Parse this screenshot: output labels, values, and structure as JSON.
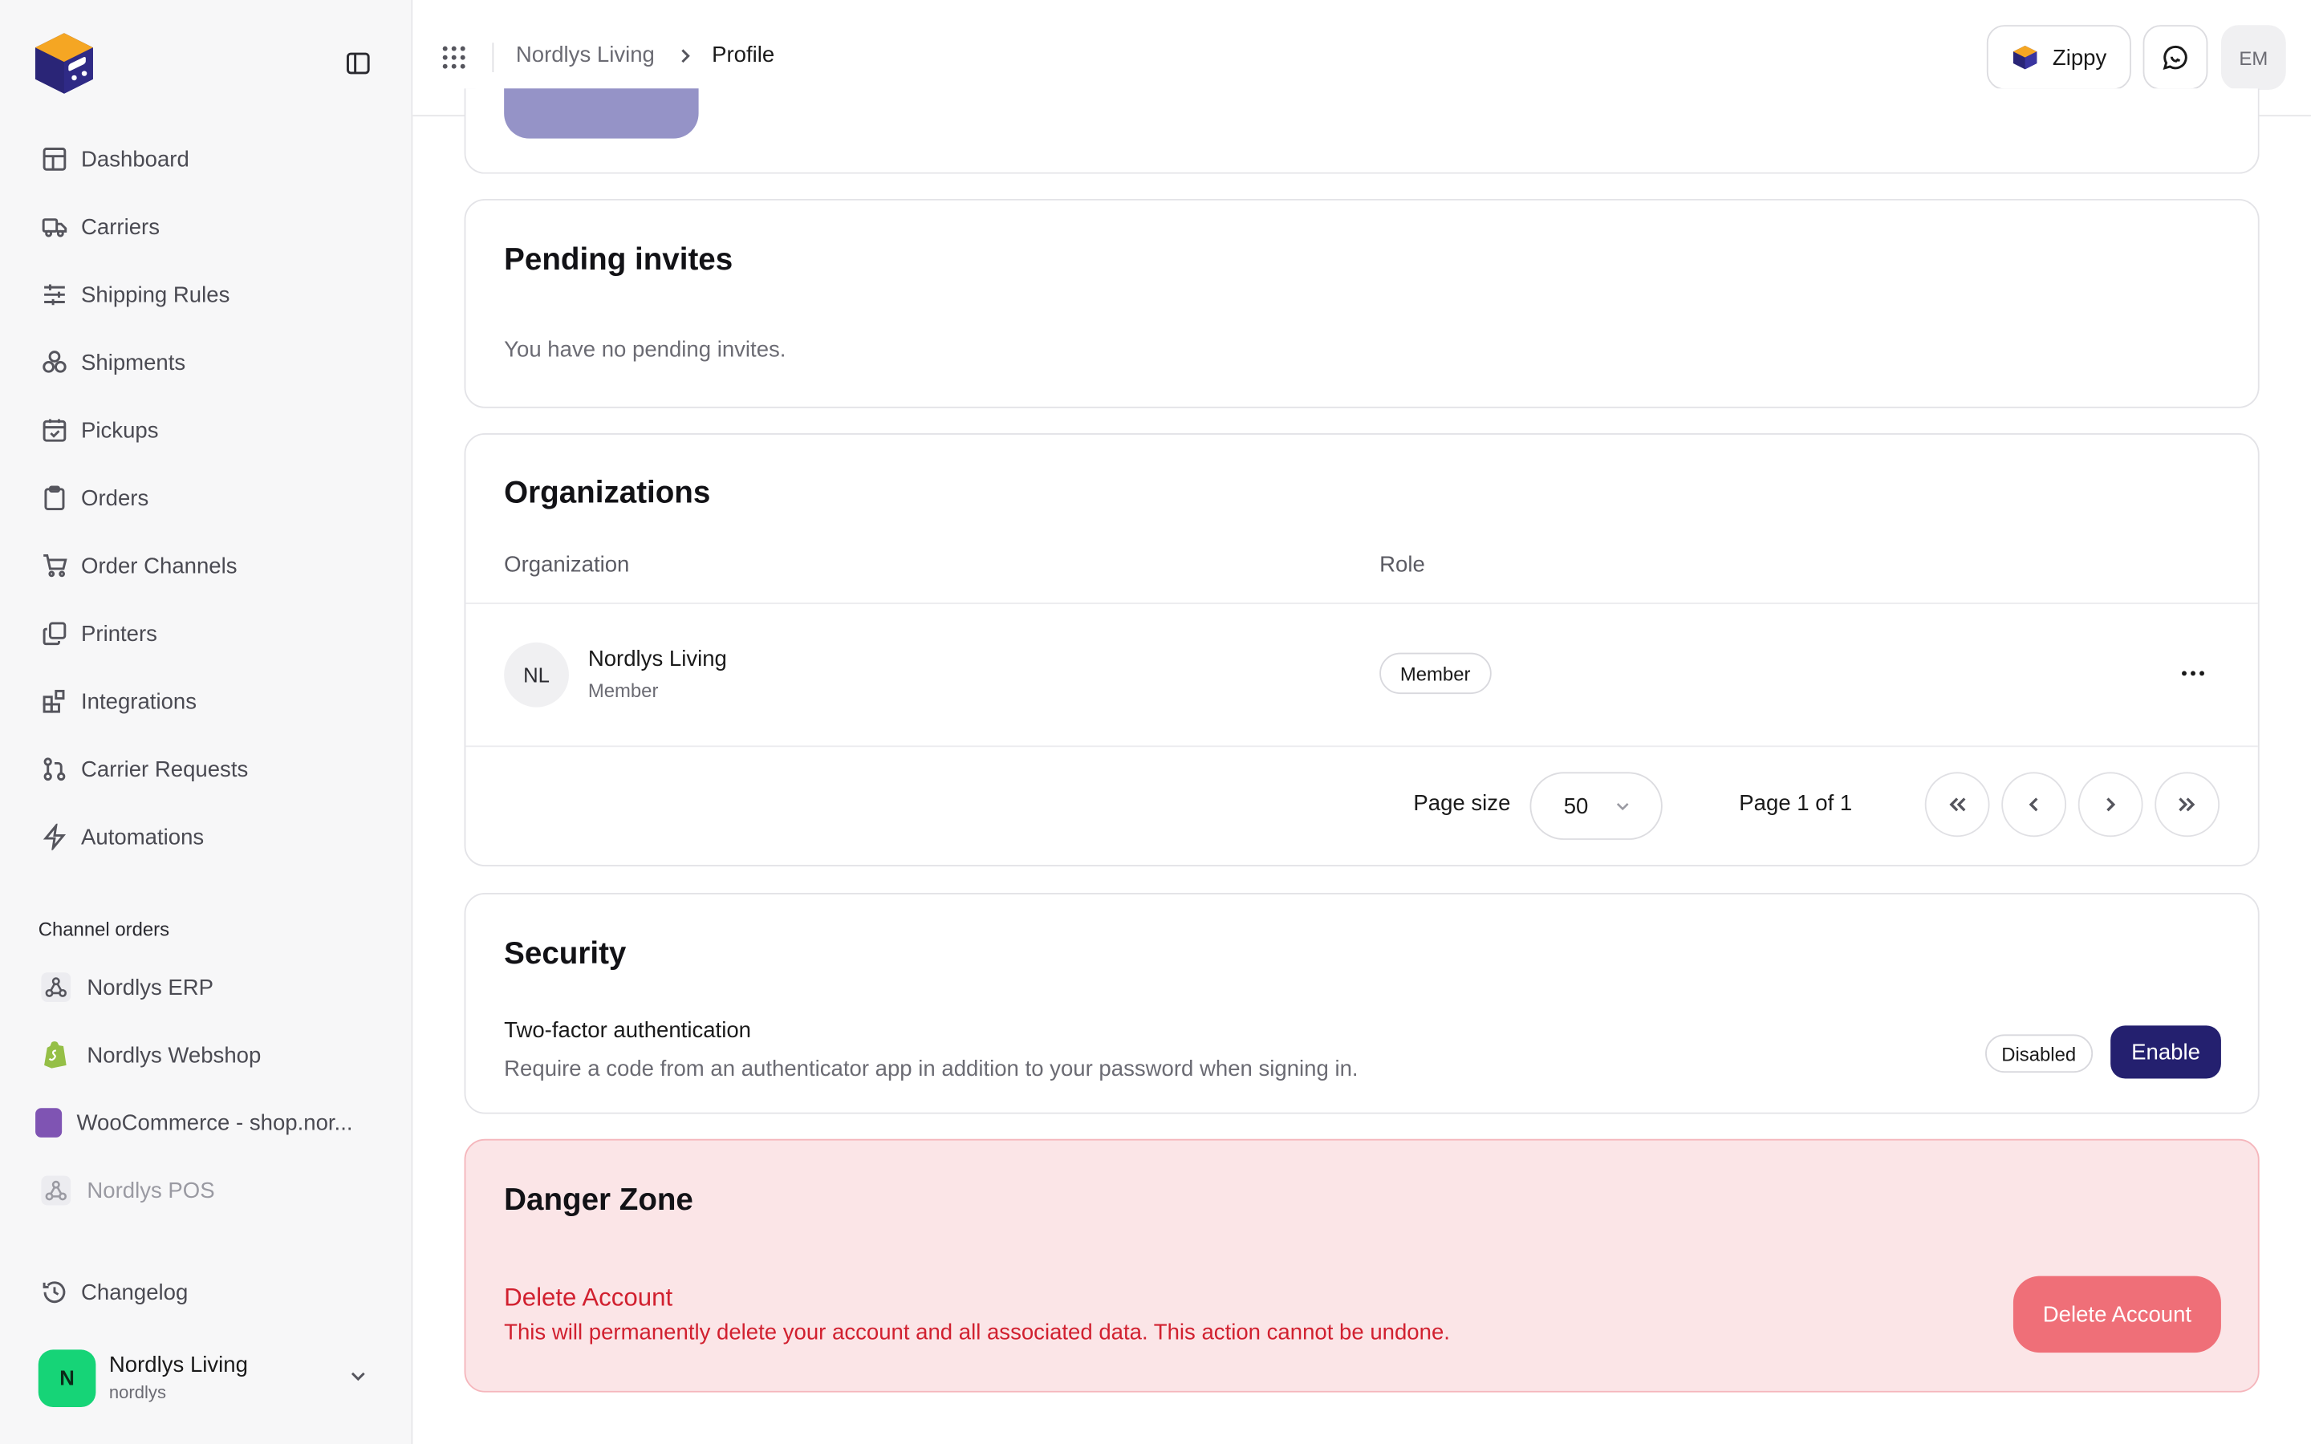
{
  "breadcrumb": {
    "org": "Nordlys Living",
    "current": "Profile"
  },
  "topbar": {
    "zippy_label": "Zippy",
    "avatar_initials": "EM"
  },
  "sidebar": {
    "items": [
      {
        "label": "Dashboard",
        "icon": "dashboard-icon"
      },
      {
        "label": "Carriers",
        "icon": "truck-icon"
      },
      {
        "label": "Shipping Rules",
        "icon": "sliders-icon"
      },
      {
        "label": "Shipments",
        "icon": "boxes-icon"
      },
      {
        "label": "Pickups",
        "icon": "calendar-check-icon"
      },
      {
        "label": "Orders",
        "icon": "clipboard-icon"
      },
      {
        "label": "Order Channels",
        "icon": "cart-icon"
      },
      {
        "label": "Printers",
        "icon": "copy-icon"
      },
      {
        "label": "Integrations",
        "icon": "blocks-icon"
      },
      {
        "label": "Carrier Requests",
        "icon": "git-pull-icon"
      },
      {
        "label": "Automations",
        "icon": "bolt-icon"
      }
    ],
    "channel_section_label": "Channel orders",
    "channels": [
      {
        "label": "Nordlys ERP",
        "icon": "webhook-icon"
      },
      {
        "label": "Nordlys Webshop",
        "icon": "shopify-icon"
      },
      {
        "label": "WooCommerce - shop.nor...",
        "icon": "woocommerce-icon"
      },
      {
        "label": "Nordlys POS",
        "icon": "webhook-icon"
      }
    ],
    "changelog_label": "Changelog",
    "user": {
      "initial": "N",
      "name": "Nordlys Living",
      "handle": "nordlys"
    }
  },
  "pending": {
    "title": "Pending invites",
    "empty_text": "You have no pending invites."
  },
  "organizations": {
    "title": "Organizations",
    "columns": [
      "Organization",
      "Role"
    ],
    "rows": [
      {
        "initials": "NL",
        "name": "Nordlys Living",
        "sub": "Member",
        "role": "Member"
      }
    ],
    "pagination": {
      "page_size_label": "Page size",
      "page_size": "50",
      "page_info": "Page 1 of 1"
    }
  },
  "security": {
    "title": "Security",
    "item_title": "Two-factor authentication",
    "item_desc": "Require a code from an authenticator app in addition to your password when signing in.",
    "status": "Disabled",
    "action": "Enable"
  },
  "danger": {
    "title": "Danger Zone",
    "item_title": "Delete Account",
    "item_desc": "This will permanently delete your account and all associated data. This action cannot be undone.",
    "action": "Delete Account"
  },
  "colors": {
    "brand": "#24206f",
    "accent_orange": "#f5a623",
    "danger": "#d1202f",
    "success": "#16d477"
  }
}
